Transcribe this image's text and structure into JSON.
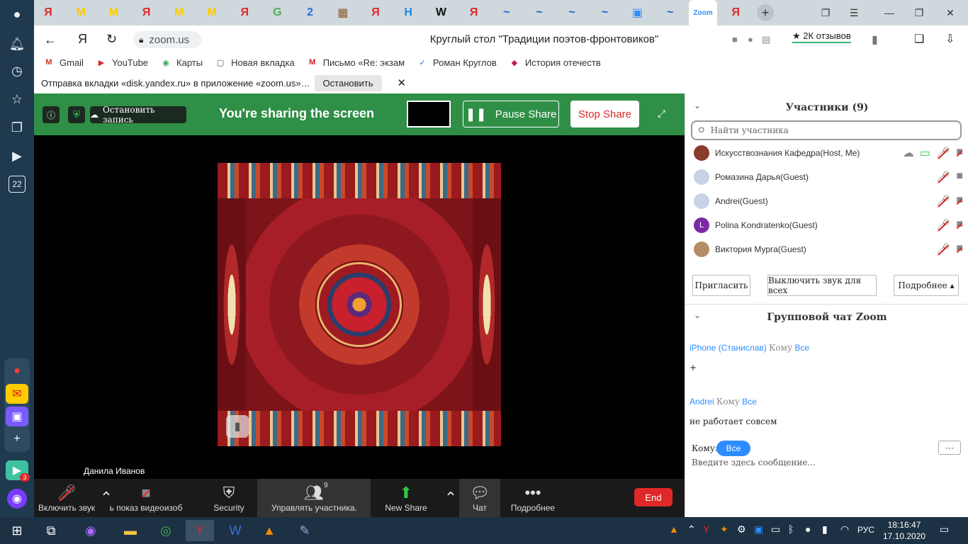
{
  "sidebar": {
    "badge_count": "3",
    "calendar_day": "22"
  },
  "browser": {
    "tabs": [
      "Я",
      "М",
      "М",
      "Я",
      "М",
      "М",
      "Я",
      "G",
      "2",
      "▦",
      "Я",
      "H",
      "W",
      "Я",
      "~",
      "~",
      "~",
      "~",
      "▣",
      "~",
      "Zoom",
      "Я"
    ],
    "address": {
      "domain": "zoom.us"
    },
    "page_title": "Круглый стол \"Традиции поэтов-фронтовиков\"",
    "reviews_label": "★ 2К отзывов",
    "bookmarks": [
      "Gmail",
      "YouTube",
      "Карты",
      "Новая вкладка",
      "Письмо «Re: экзам",
      "Роман Круглов",
      "История отечеств"
    ],
    "infobar": {
      "text": "Отправка вкладки «disk.yandex.ru» в приложение «zoom.us»…",
      "stop_label": "Остановить",
      "close_label": "✕"
    }
  },
  "sharebar": {
    "stop_record_label": "Остановить запись",
    "sharing_text": "You're sharing the screen",
    "pause_label": "Pause Share",
    "stop_label": "Stop Share"
  },
  "stage": {
    "presenter_name": "Данила Иванов"
  },
  "toolbar": {
    "audio_label": "Включить звук",
    "video_label": "ь показ видеоизоб",
    "security_label": "Security",
    "participants_label": "Управлять участника...",
    "participants_count": "9",
    "new_share_label": "New Share",
    "chat_label": "Чат",
    "more_label": "Подробнее",
    "end_label": "End"
  },
  "participants": {
    "title": "Участники (9)",
    "search_placeholder": "Найти участника",
    "list": [
      {
        "name": "Искусствознания Кафедра(Host, Me)",
        "avatar_letter": "",
        "avatar_color": "#8a3b2b"
      },
      {
        "name": "Ромазина Дарья(Guest)",
        "avatar_letter": "",
        "avatar_color": "#c9d3e6"
      },
      {
        "name": "Andrei(Guest)",
        "avatar_letter": "",
        "avatar_color": "#c9d3e6"
      },
      {
        "name": "Polina Kondratenko(Guest)",
        "avatar_letter": "L",
        "avatar_color": "#7b2aa6"
      },
      {
        "name": "Виктория Мурга(Guest)",
        "avatar_letter": "",
        "avatar_color": "#b48d66"
      }
    ],
    "invite_label": "Пригласить",
    "mute_all_label": "Выключить звук для всех",
    "more_label": "Подробнее ▴"
  },
  "chat": {
    "title": "Групповой чат Zoom",
    "messages": [
      {
        "from": "iPhone (Станислав)",
        "to_word": "Кому",
        "to": "Все",
        "text": "+"
      },
      {
        "from": "Andrei",
        "to_word": "Кому",
        "to": "Все",
        "text": "не работает совсем"
      }
    ],
    "to_label": "Кому:",
    "to_value": "Все",
    "more_label": "···",
    "input_placeholder": "Введите здесь сообщение..."
  },
  "taskbar": {
    "lang": "РУС",
    "time": "18:16:47",
    "date": "17.10.2020"
  }
}
